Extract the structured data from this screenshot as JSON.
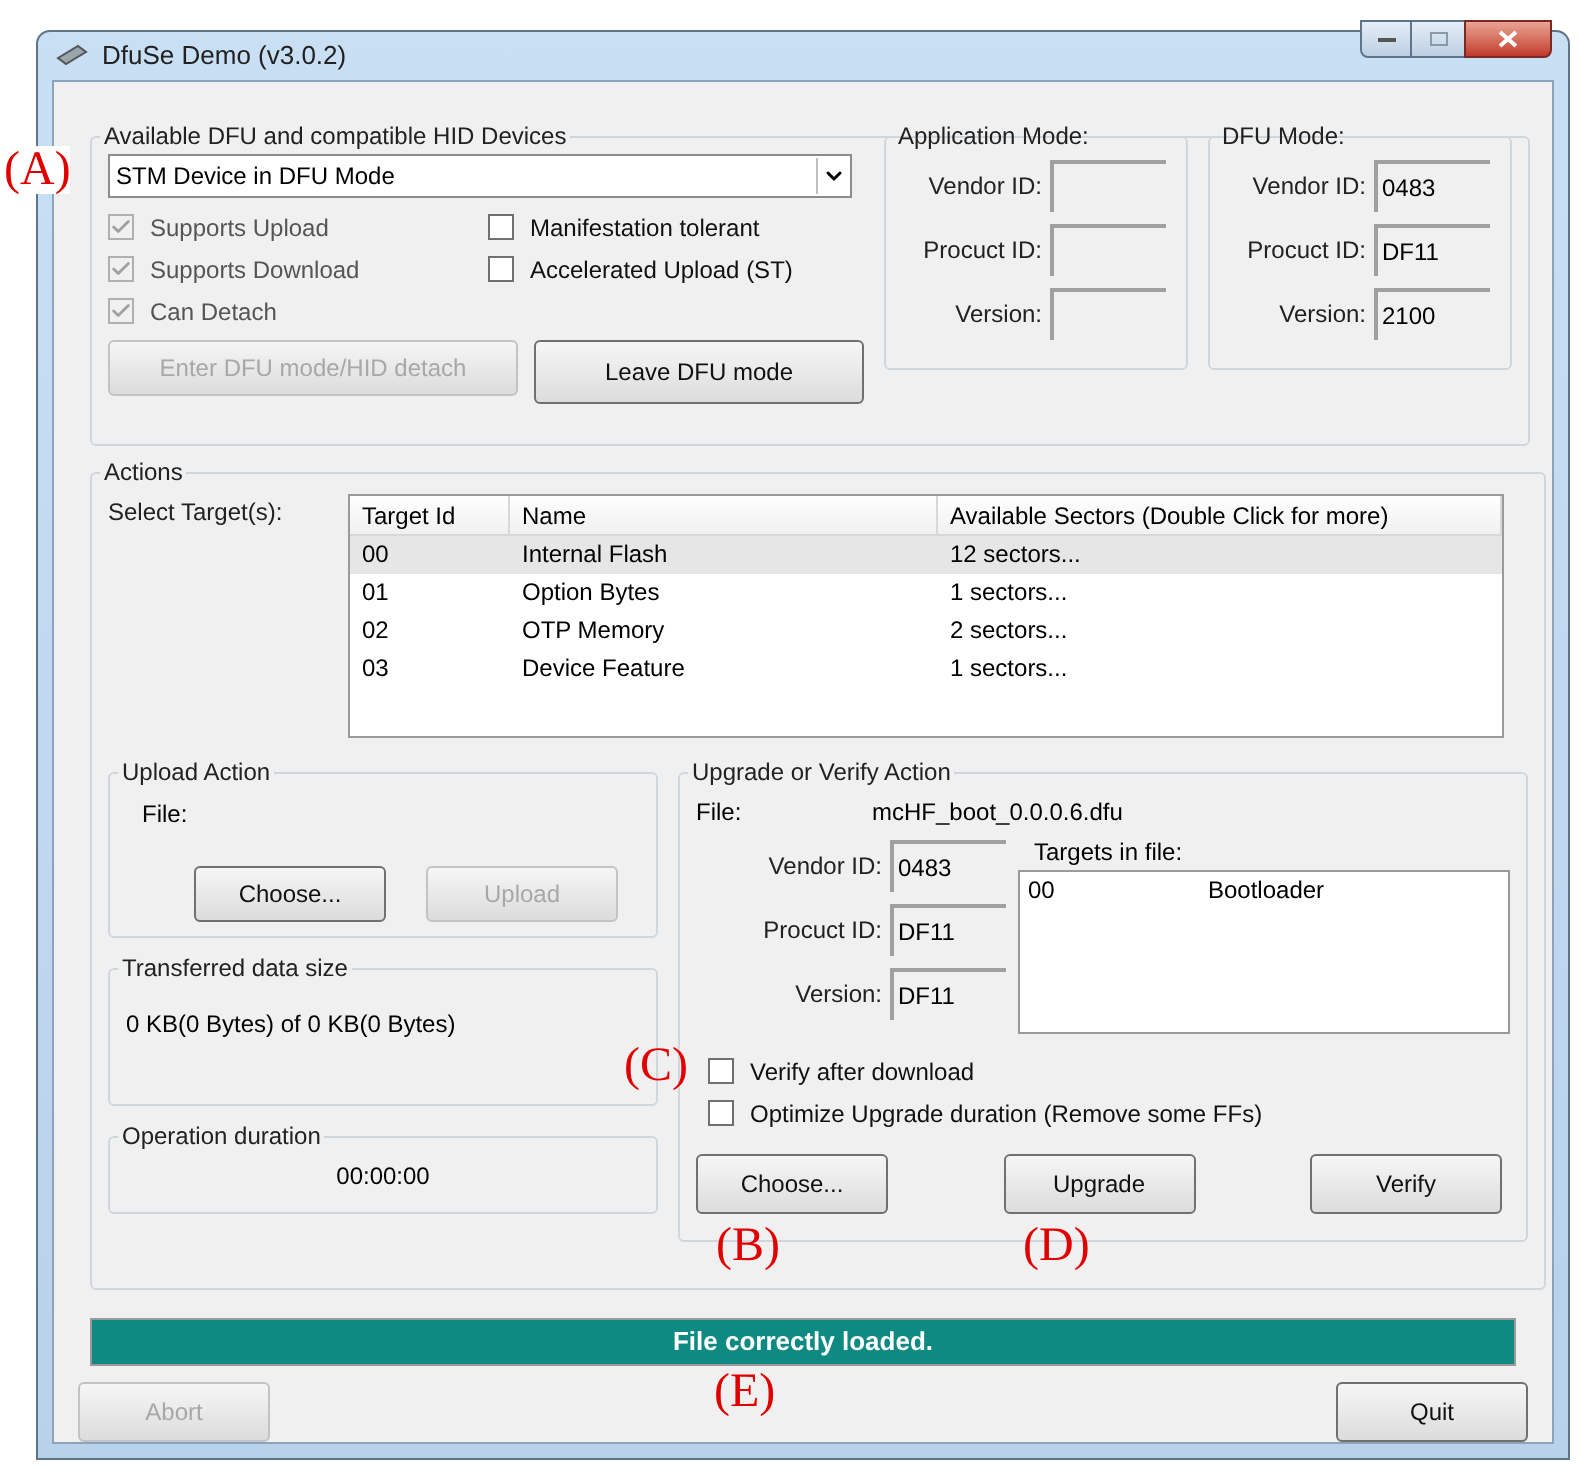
{
  "window": {
    "title": "DfuSe Demo (v3.0.2)"
  },
  "devices": {
    "title": "Available DFU and compatible HID Devices",
    "selected_device": "STM Device in DFU Mode",
    "annotation": "(A)",
    "options": [
      {
        "label": "Supports Upload",
        "checked": true,
        "disabled": true
      },
      {
        "label": "Manifestation tolerant",
        "checked": false,
        "disabled": false
      },
      {
        "label": "Supports Download",
        "checked": true,
        "disabled": true
      },
      {
        "label": "Accelerated Upload (ST)",
        "checked": false,
        "disabled": false
      },
      {
        "label": "Can Detach",
        "checked": true,
        "disabled": true
      }
    ],
    "buttons": [
      {
        "label": "Enter DFU mode/HID detach",
        "disabled": true
      },
      {
        "label": "Leave DFU mode",
        "disabled": false
      }
    ],
    "application_mode": {
      "title": "Application Mode:",
      "fields": [
        {
          "label": "Vendor ID:"
        },
        {
          "label": "Procuct ID:"
        },
        {
          "label": "Version:"
        }
      ]
    },
    "dfu_mode": {
      "title": "DFU Mode:",
      "fields": [
        {
          "label": "Vendor ID:",
          "value": "0483"
        },
        {
          "label": "Procuct ID:",
          "value": "DF11"
        },
        {
          "label": "Version:",
          "value": "2100"
        }
      ]
    }
  },
  "actions": {
    "title": "Actions",
    "select_label": "Select Target(s):",
    "table": {
      "columns": [
        "Target Id",
        "Name",
        "Available Sectors (Double Click for more)"
      ],
      "rows": [
        {
          "cells": [
            "00",
            "Internal Flash",
            "12 sectors..."
          ],
          "selected": true
        },
        {
          "cells": [
            "01",
            "Option Bytes",
            "1 sectors..."
          ],
          "selected": false
        },
        {
          "cells": [
            "02",
            "OTP Memory",
            "2 sectors..."
          ],
          "selected": false
        },
        {
          "cells": [
            "03",
            "Device Feature",
            "1 sectors..."
          ],
          "selected": false
        }
      ]
    },
    "upload": {
      "title": "Upload Action",
      "file_label": "File:",
      "buttons": [
        {
          "label": "Choose...",
          "disabled": false
        },
        {
          "label": "Upload",
          "disabled": true
        }
      ]
    },
    "transferred": {
      "title": "Transferred data size",
      "text": "0 KB(0 Bytes) of 0 KB(0 Bytes)"
    },
    "duration": {
      "title": "Operation duration",
      "text": "00:00:00"
    },
    "upgrade": {
      "title": "Upgrade or Verify Action",
      "file_label": "File:",
      "file": "mcHF_boot_0.0.0.6.dfu",
      "fields": [
        {
          "label": "Vendor ID:",
          "value": "0483"
        },
        {
          "label": "Procuct ID:",
          "value": "DF11"
        },
        {
          "label": "Version:",
          "value": "DF11"
        }
      ],
      "targets_title": "Targets in file:",
      "targets": [
        {
          "id": "00",
          "name": "Bootloader"
        }
      ],
      "options": [
        {
          "label": "Verify after download",
          "checked": false,
          "annotation": "(C)"
        },
        {
          "label": "Optimize Upgrade duration (Remove some FFs)",
          "checked": false
        }
      ],
      "buttons": [
        {
          "label": "Choose...",
          "disabled": false,
          "annotation": "(B)"
        },
        {
          "label": "Upgrade",
          "disabled": false,
          "annotation": "(D)"
        },
        {
          "label": "Verify",
          "disabled": false
        }
      ]
    }
  },
  "status": {
    "text": "File correctly loaded.",
    "level": 1,
    "annotation": "(E)"
  },
  "footer_buttons": [
    {
      "label": "Abort",
      "disabled": true
    },
    {
      "label": "Quit",
      "disabled": false
    }
  ]
}
